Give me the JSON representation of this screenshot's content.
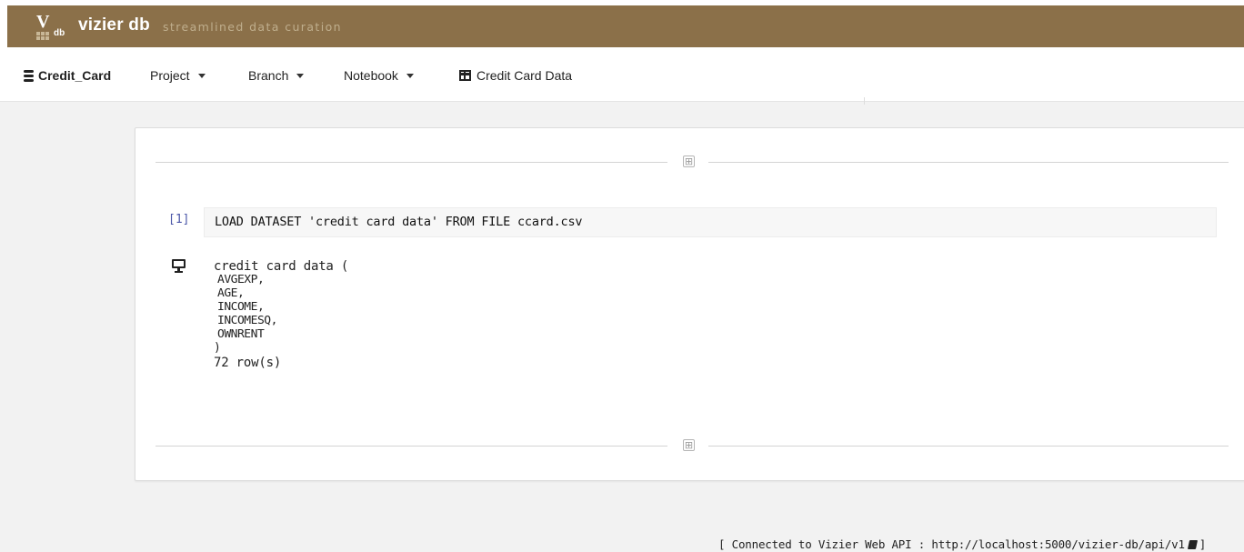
{
  "brand": {
    "logo_letter": "V",
    "logo_sub": "db",
    "name": "vizier db",
    "tagline": "streamlined data curation",
    "bar_color": "#8b7049"
  },
  "nav": {
    "project_name": "Credit_Card",
    "project_icon": "database-icon",
    "menus": [
      {
        "label": "Project"
      },
      {
        "label": "Branch"
      },
      {
        "label": "Notebook"
      }
    ],
    "dataset_link": {
      "label": "Credit Card Data",
      "icon": "table-icon"
    }
  },
  "notebook": {
    "cells": [
      {
        "index": "[1]",
        "command": "LOAD DATASET 'credit card data' FROM FILE ccard.csv",
        "output": {
          "icon": "desktop-icon",
          "header": "credit card data (",
          "columns": [
            "AVGEXP,",
            "AGE,",
            "INCOME,",
            "INCOMESQ,",
            "OWNRENT"
          ],
          "close": ")",
          "rows": "72 row(s)"
        }
      }
    ],
    "insert_label": "⊞"
  },
  "footer": {
    "prefix": "[ Connected to Vizier Web API : http://localhost:5000/vizier-db/api/v1",
    "suffix": "]",
    "icon": "book-icon"
  }
}
